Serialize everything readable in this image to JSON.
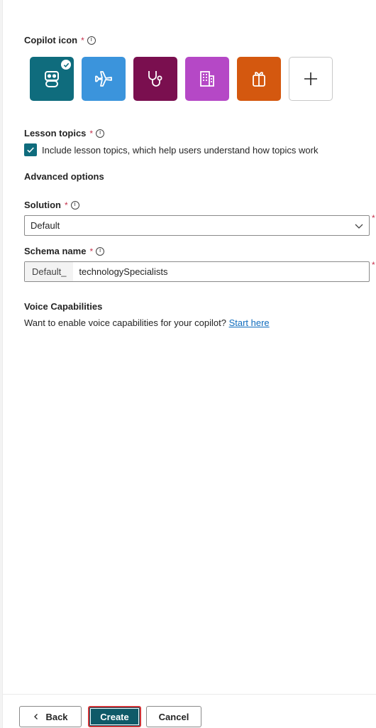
{
  "copilot_icon": {
    "label": "Copilot icon",
    "required_mark": "*",
    "tiles": [
      {
        "name": "bot-icon",
        "color": "#0f6c7d",
        "selected": true
      },
      {
        "name": "airplane-icon",
        "color": "#3b94dc"
      },
      {
        "name": "stethoscope-icon",
        "color": "#7a0f4f"
      },
      {
        "name": "building-icon",
        "color": "#b548c6"
      },
      {
        "name": "gift-icon",
        "color": "#d4580f"
      },
      {
        "name": "plus-icon",
        "color": "#ffffff"
      }
    ]
  },
  "lesson_topics": {
    "label": "Lesson topics",
    "required_mark": "*",
    "checkbox_label": "Include lesson topics, which help users understand how topics work",
    "checked": true
  },
  "advanced": {
    "heading": "Advanced options"
  },
  "solution": {
    "label": "Solution",
    "required_mark": "*",
    "value": "Default"
  },
  "schema_name": {
    "label": "Schema name",
    "required_mark": "*",
    "prefix": "Default_",
    "value": "technologySpecialists"
  },
  "voice": {
    "heading": "Voice Capabilities",
    "text": "Want to enable voice capabilities for your copilot?",
    "link": "Start here"
  },
  "footer": {
    "back_label": "Back",
    "create_label": "Create",
    "cancel_label": "Cancel"
  },
  "colors": {
    "accent": "#0f6c7d",
    "required": "#c4314b",
    "link": "#0f6cbd",
    "focus_outline": "#d13438"
  }
}
